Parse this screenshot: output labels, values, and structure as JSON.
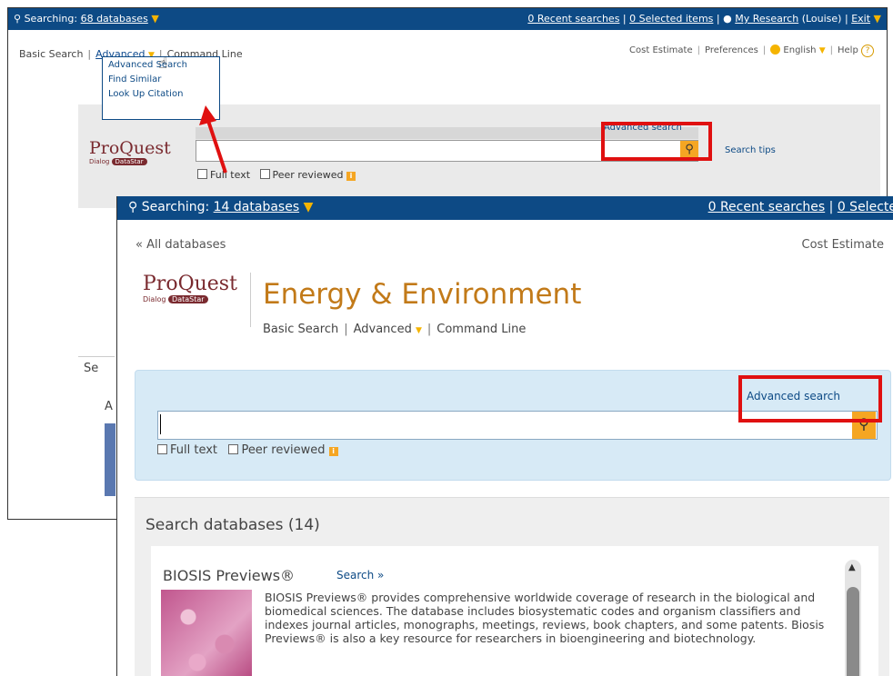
{
  "back_window": {
    "topbar": {
      "searching_prefix": "Searching:",
      "databases_link": "68 databases",
      "recent_searches": "0 Recent searches",
      "selected_items": "0 Selected items",
      "my_research": "My Research",
      "user": "(Louise)",
      "exit": "Exit",
      "separator": "|"
    },
    "nav": {
      "basic": "Basic Search",
      "advanced": "Advanced",
      "command": "Command Line",
      "sep": "|"
    },
    "utility": {
      "cost": "Cost Estimate",
      "prefs": "Preferences",
      "language": "English",
      "help": "Help",
      "help_glyph": "?",
      "sep": "|"
    },
    "dropdown": [
      "Advanced Search",
      "Find Similar",
      "Look Up Citation"
    ],
    "logo": {
      "name": "ProQuest",
      "sub1": "Dialog",
      "sub2": "DataStar"
    },
    "search": {
      "advanced_link": "Advanced search",
      "tips": "Search tips",
      "full_text": "Full text",
      "peer_reviewed": "Peer reviewed"
    },
    "partial_texts": {
      "se": "Se",
      "a": "A"
    }
  },
  "front_window": {
    "topbar": {
      "searching_prefix": "Searching:",
      "databases_link": "14 databases",
      "recent_searches": "0 Recent searches",
      "selected": "0 Selecte",
      "separator": "|"
    },
    "all_databases": "« All databases",
    "cost_estimate": "Cost Estimate",
    "logo": {
      "name": "ProQuest",
      "sub1": "Dialog",
      "sub2": "DataStar"
    },
    "title": "Energy & Environment",
    "nav": {
      "basic": "Basic Search",
      "advanced": "Advanced",
      "command": "Command Line",
      "sep": "|"
    },
    "search": {
      "advanced_link": "Advanced search",
      "full_text": "Full text",
      "peer_reviewed": "Peer reviewed"
    },
    "databases": {
      "heading": "Search databases (14)",
      "items": [
        {
          "name": "BIOSIS Previews®",
          "search_link": "Search »",
          "description": "BIOSIS Previews® provides comprehensive worldwide coverage of research in the biological and biomedical sciences. The database includes biosystematic codes and organism classifiers and indexes journal articles, monographs, meetings, reviews, book chapters, and some patents. Biosis Previews® is also a key resource for researchers in bioengineering and biotechnology."
        }
      ]
    }
  },
  "colors": {
    "topbar": "#0d4a85",
    "accent_orange": "#f5a623",
    "title_orange": "#c27a19",
    "annotation_red": "#e01010",
    "search_panel": "#d7eaf6"
  },
  "icons": [
    "search-icon",
    "chevron-down-icon",
    "user-icon",
    "globe-icon",
    "help-icon",
    "info-icon",
    "hand-cursor-icon",
    "scroll-up-icon"
  ]
}
